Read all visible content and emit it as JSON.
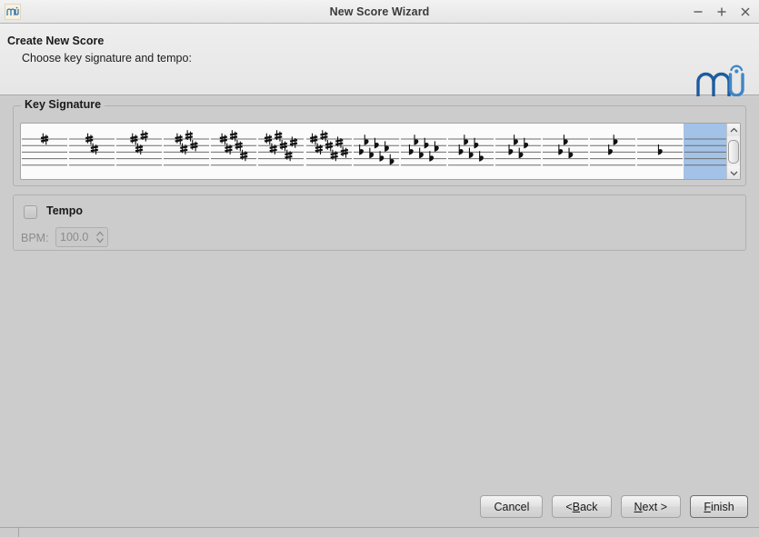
{
  "window": {
    "title": "New Score Wizard",
    "app_icon": "musescore-logo-icon",
    "buttons": {
      "minimize": "minimize-icon",
      "maximize": "maximize-icon",
      "close": "close-icon"
    }
  },
  "header": {
    "title": "Create New Score",
    "subtitle": "Choose key signature and tempo:",
    "logo": "musescore-logo"
  },
  "key_signature": {
    "group_label": "Key Signature",
    "selected_index": 14,
    "items": [
      {
        "name": "1-sharp",
        "accidental": "sharp",
        "count": 1
      },
      {
        "name": "2-sharps",
        "accidental": "sharp",
        "count": 2
      },
      {
        "name": "3-sharps",
        "accidental": "sharp",
        "count": 3
      },
      {
        "name": "4-sharps",
        "accidental": "sharp",
        "count": 4
      },
      {
        "name": "5-sharps",
        "accidental": "sharp",
        "count": 5
      },
      {
        "name": "6-sharps",
        "accidental": "sharp",
        "count": 6
      },
      {
        "name": "7-sharps",
        "accidental": "sharp",
        "count": 7
      },
      {
        "name": "7-flats",
        "accidental": "flat",
        "count": 7
      },
      {
        "name": "6-flats",
        "accidental": "flat",
        "count": 6
      },
      {
        "name": "5-flats",
        "accidental": "flat",
        "count": 5
      },
      {
        "name": "4-flats",
        "accidental": "flat",
        "count": 4
      },
      {
        "name": "3-flats",
        "accidental": "flat",
        "count": 3
      },
      {
        "name": "2-flats",
        "accidental": "flat",
        "count": 2
      },
      {
        "name": "1-flat",
        "accidental": "flat",
        "count": 1
      },
      {
        "name": "no-accidentals",
        "accidental": "none",
        "count": 0
      }
    ],
    "scrollbar": {
      "up_arrow": "chevron-up-icon",
      "down_arrow": "chevron-down-icon"
    }
  },
  "tempo": {
    "label": "Tempo",
    "checked": false,
    "bpm_label": "BPM:",
    "bpm_value": "100.0",
    "enabled": false,
    "spinner_icon": "spinner-updown-icon"
  },
  "footer": {
    "buttons": [
      {
        "name": "cancel-button",
        "pre": "",
        "mnemonic": "",
        "post": "Cancel",
        "default": false
      },
      {
        "name": "back-button",
        "pre": "< ",
        "mnemonic": "B",
        "post": "ack",
        "default": false
      },
      {
        "name": "next-button",
        "pre": "",
        "mnemonic": "N",
        "post": "ext >",
        "default": false
      },
      {
        "name": "finish-button",
        "pre": "",
        "mnemonic": "F",
        "post": "inish",
        "default": true
      }
    ]
  },
  "colors": {
    "window_bg": "#cccccc",
    "header_bg": "#ececec",
    "selection_blue": "#a3c2e8",
    "list_bg": "#fbfbfb",
    "logo_dark": "#1d5c9e",
    "logo_light": "#3f86c6",
    "text": "#1a1a1a",
    "disabled_text": "#8c8c8c"
  }
}
